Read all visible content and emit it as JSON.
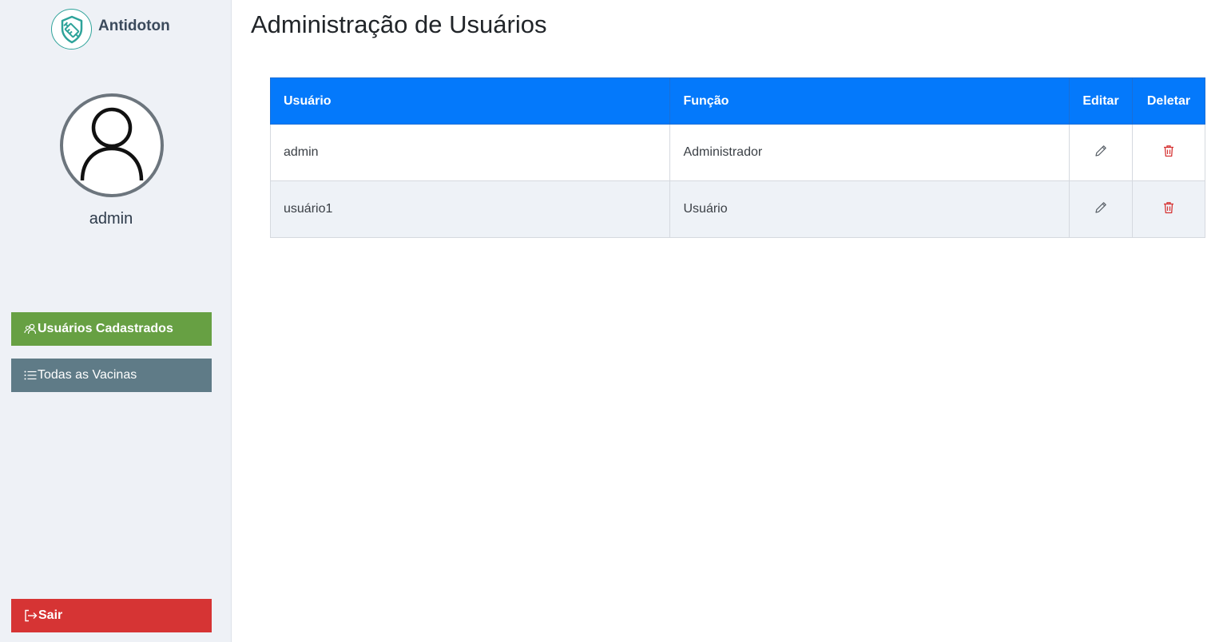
{
  "brand": {
    "name": "Antidoton"
  },
  "profile": {
    "username": "admin"
  },
  "sidebar": {
    "items": [
      {
        "label": "Usuários Cadastrados",
        "icon": "users-icon",
        "color": "#67a043"
      },
      {
        "label": "Todas as Vacinas",
        "icon": "list-icon",
        "color": "#5f7b87"
      }
    ],
    "logout": {
      "label": "Sair",
      "icon": "logout-icon",
      "color": "#d63434"
    }
  },
  "main": {
    "title": "Administração de Usuários",
    "table": {
      "headers": [
        "Usuário",
        "Função",
        "Editar",
        "Deletar"
      ],
      "rows": [
        {
          "user": "admin",
          "role": "Administrador"
        },
        {
          "user": "usuário1",
          "role": "Usuário"
        }
      ]
    }
  },
  "colors": {
    "accent": "#0479fb",
    "delete": "#d63434"
  }
}
